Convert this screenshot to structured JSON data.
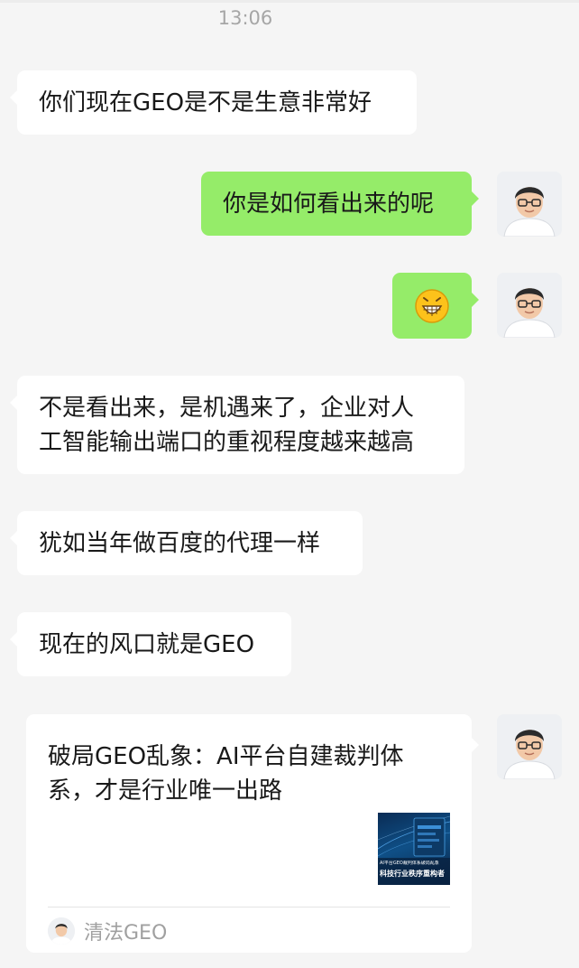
{
  "chat": {
    "timestamp": "13:06",
    "messages": [
      {
        "side": "left",
        "text": "你们现在GEO是不是生意非常好"
      },
      {
        "side": "right",
        "text": "你是如何看出来的呢"
      },
      {
        "side": "right",
        "emoji": "grinning-face"
      },
      {
        "side": "left",
        "lines": [
          "不是看出来，是机遇来了，企业对人",
          "工智能输出端口的重视程度越来越高"
        ]
      },
      {
        "side": "left",
        "text": "犹如当年做百度的代理一样"
      },
      {
        "side": "left",
        "text": "现在的风口就是GEO"
      }
    ],
    "card": {
      "title_lines": [
        "破局GEO乱象：AI平台自建裁判体",
        "系，才是行业唯一出路"
      ],
      "thumb_caption_small": "AI平台GEO裁判体系破局乱象",
      "thumb_caption_large": "科技行业秩序重构者",
      "source": "清法GEO"
    }
  },
  "colors": {
    "background": "#f5f5f5",
    "bubble_right": "#95ec69",
    "bubble_left": "#ffffff"
  }
}
